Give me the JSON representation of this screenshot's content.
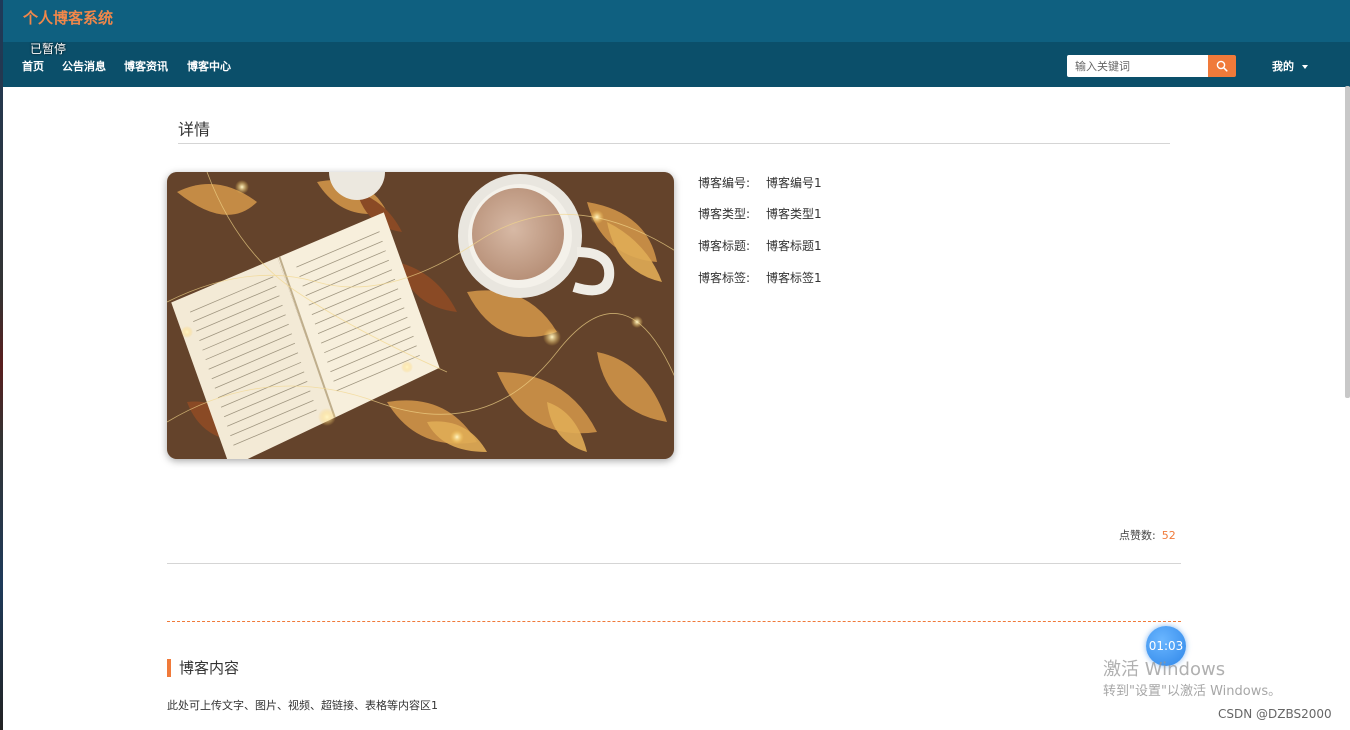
{
  "header": {
    "site_title": "个人博客系统",
    "paused_label": "已暂停"
  },
  "nav": {
    "items": [
      {
        "label": "首页"
      },
      {
        "label": "公告消息"
      },
      {
        "label": "博客资讯"
      },
      {
        "label": "博客中心"
      }
    ],
    "search_placeholder": "输入关键词",
    "user_menu": "我的",
    "search_icon": "search-icon"
  },
  "detail": {
    "section_title": "详情",
    "fields": [
      {
        "label": "博客编号:",
        "value": "博客编号1"
      },
      {
        "label": "博客类型:",
        "value": "博客类型1"
      },
      {
        "label": "博客标题:",
        "value": "博客标题1"
      },
      {
        "label": "博客标签:",
        "value": "博客标签1"
      }
    ],
    "likes_label": "点赞数:",
    "likes_value": "52"
  },
  "content": {
    "heading": "博客内容",
    "body": "此处可上传文字、图片、视频、超链接、表格等内容区1"
  },
  "overlay": {
    "timer": "01:03",
    "activate_title": "激活 Windows",
    "activate_hint": "转到\"设置\"以激活 Windows。",
    "csdn": "CSDN @DZBS2000"
  },
  "colors": {
    "topbar": "#0f6080",
    "navbar": "#0b4f6a",
    "accent": "#f07a3a"
  }
}
